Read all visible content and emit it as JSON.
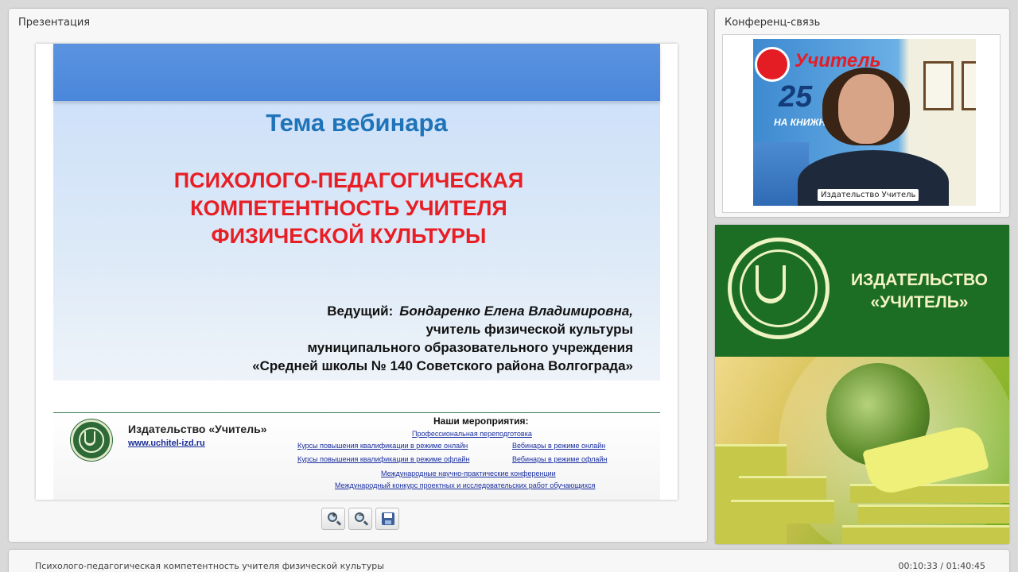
{
  "presentation": {
    "title": "Презентация",
    "slide": {
      "heading": "Тема вебинара",
      "topic": "ПСИХОЛОГО-ПЕДАГОГИЧЕСКАЯ\nКОМПЕТЕНТНОСТЬ УЧИТЕЛЯ\nФИЗИЧЕСКОЙ КУЛЬТУРЫ",
      "presenter_label": "Ведущий:",
      "presenter_name": "Бондаренко Елена Владимировна,",
      "presenter_lines": [
        "учитель физической культуры",
        "муниципального образовательного учреждения",
        "«Средней школы № 140 Советского района Волгограда»"
      ],
      "footer": {
        "publisher": "Издательство «Учитель»",
        "site": "www.uchitel-izd.ru",
        "events_title": "Наши мероприятия:",
        "events": [
          "Профессиональная переподготовка",
          "Курсы повышения квалификации в режиме онлайн",
          "Вебинары в режиме онлайн",
          "Курсы повышения квалификации в режиме офлайн",
          "Вебинары в режиме офлайн",
          "Международные научно-практические конференции",
          "Международный конкурс проектных и исследовательских работ обучающихся"
        ]
      }
    },
    "controls": {
      "zoom_in_icon": "zoom-in-icon",
      "zoom_out_icon": "zoom-out-icon",
      "save_icon": "save-icon"
    }
  },
  "conference": {
    "title": "Конференц-связь",
    "video_label": "Издательство Учитель",
    "poster": {
      "title": "Учитель",
      "number": "25",
      "subtitle": "НА КНИЖН"
    }
  },
  "brand": {
    "name": "ИЗДАТЕЛЬСТВО\n«УЧИТЕЛЬ»"
  },
  "status": {
    "title": "Психолого-педагогическая компетентность учителя физической культуры",
    "time": "00:10:33 / 01:40:45"
  },
  "colors": {
    "slide_heading": "#1f73b8",
    "slide_topic": "#e81e25",
    "brand_green": "#1c6e24",
    "link": "#1a2fa0"
  }
}
